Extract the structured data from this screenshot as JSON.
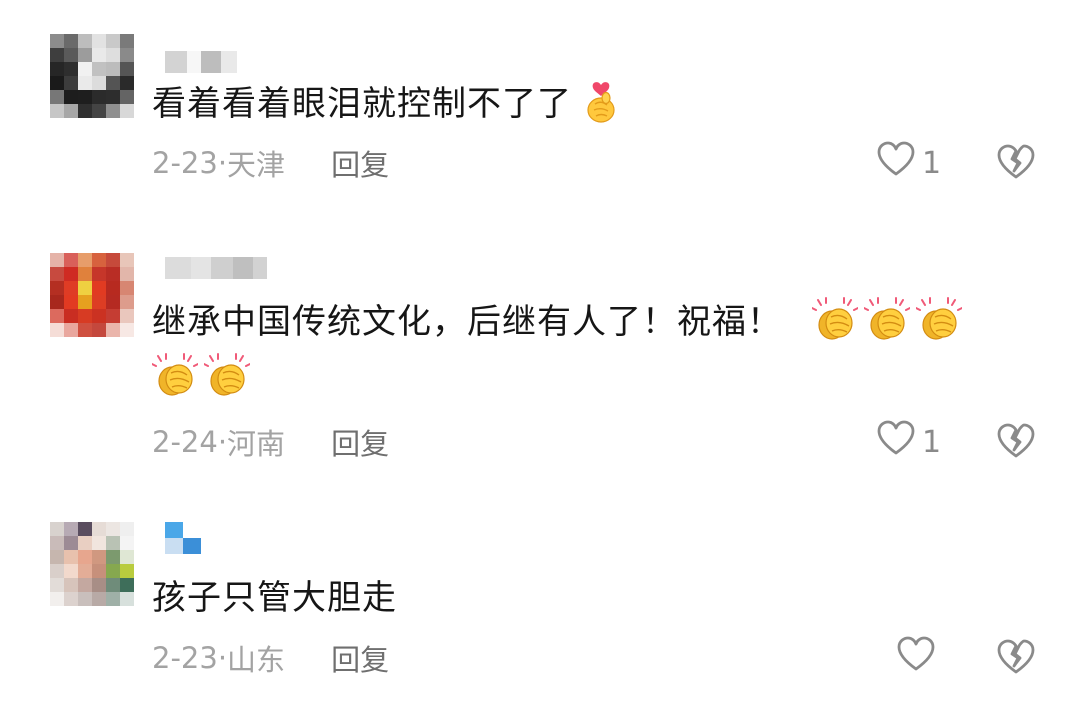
{
  "comments": [
    {
      "text": "看着看着眼泪就控制不了了",
      "emojis": [
        "finger-heart-emoji"
      ],
      "date": "2-23",
      "separator": "·",
      "location": "天津",
      "reply_label": "回复",
      "like_count": "1",
      "avatar_colors": [
        "#8c8c8c",
        "#6a6a6a",
        "#bdbdbd",
        "#e2e2e2",
        "#c9c9c9",
        "#7a7a7a",
        "#3e3e3e",
        "#5a5a5a",
        "#9c9c9c",
        "#e9e9e9",
        "#dedede",
        "#8a8a8a",
        "#262626",
        "#2e2e2e",
        "#f1f1f1",
        "#c1c1c1",
        "#bcbcbc",
        "#555555",
        "#1a1a1a",
        "#3c3c3c",
        "#eaeaea",
        "#dcdcdc",
        "#545454",
        "#2a2a2a",
        "#777777",
        "#1d1d1d",
        "#1e1e1e",
        "#2b2b2b",
        "#2d2d2d",
        "#646464",
        "#c6c6c6",
        "#a7a7a7",
        "#2f2f2f",
        "#444444",
        "#8f8f8f",
        "#d8d8d8"
      ],
      "username_colors": [
        "#d3d3d3",
        "#f7f7f7",
        "#bdbdbd",
        "#e9e9e9"
      ]
    },
    {
      "text": "继承中国传统文化，后继有人了！祝福！",
      "emojis": [
        "clapping-hands-emoji",
        "clapping-hands-emoji",
        "clapping-hands-emoji",
        "clapping-hands-emoji",
        "clapping-hands-emoji"
      ],
      "date": "2-24",
      "separator": "·",
      "location": "河南",
      "reply_label": "回复",
      "like_count": "1",
      "avatar_colors": [
        "#e5b3a8",
        "#d9605a",
        "#e79d6a",
        "#d7623e",
        "#c64a3b",
        "#e8c6b9",
        "#c74a3f",
        "#cf2b23",
        "#e0813c",
        "#c6362a",
        "#b92d25",
        "#e2b6aa",
        "#b42f22",
        "#df3c25",
        "#efd041",
        "#e13b22",
        "#b72a20",
        "#d78672",
        "#a8281d",
        "#e23a22",
        "#e6a01f",
        "#dd3d24",
        "#b52a22",
        "#dd9c8c",
        "#dc6a5e",
        "#c92d22",
        "#d73b23",
        "#cb3222",
        "#c53d33",
        "#eac7bd",
        "#f5ddd7",
        "#e9a79e",
        "#cf5040",
        "#c4483d",
        "#eab5ab",
        "#f7e8e4"
      ],
      "username_colors": [
        "#dcdcdc",
        "#e4e4e4",
        "#cfcfcf",
        "#bfbfbf",
        "#d2d2d2"
      ]
    },
    {
      "text": "孩子只管大胆走",
      "emojis": [],
      "date": "2-23",
      "separator": "·",
      "location": "山东",
      "reply_label": "回复",
      "like_count": "",
      "avatar_colors": [
        "#d8d2ce",
        "#b7aab4",
        "#5a4d5f",
        "#e6dcd6",
        "#ece6e2",
        "#efefef",
        "#c9bbb9",
        "#9d8b95",
        "#e9cfc2",
        "#f1e5de",
        "#b9c2b4",
        "#f4f4f4",
        "#c6b6ae",
        "#e8c1ad",
        "#e7a68e",
        "#d09880",
        "#7c9a6e",
        "#dfe7d4",
        "#d9cfca",
        "#f2d9cc",
        "#e3ad97",
        "#c7907b",
        "#86a84f",
        "#b9cc3e",
        "#e2dcd8",
        "#d7c4bb",
        "#c4a8a0",
        "#a88e86",
        "#6f8c7a",
        "#3e6e5a",
        "#f2efed",
        "#dcd2ce",
        "#c9bfbc",
        "#b8aaa6",
        "#9fb0a7",
        "#d7e0dc"
      ],
      "username_colors": [
        "#4aa7e8",
        "#ffffff",
        "#c9def2",
        "#3b8fd8"
      ]
    }
  ],
  "icons": {
    "like": "heart-outline-icon",
    "dislike": "broken-heart-outline-icon"
  },
  "colors": {
    "meta_text": "#a3a3a3",
    "reply_text": "#6f6f6f",
    "icon_stroke": "#8a8a8a"
  }
}
